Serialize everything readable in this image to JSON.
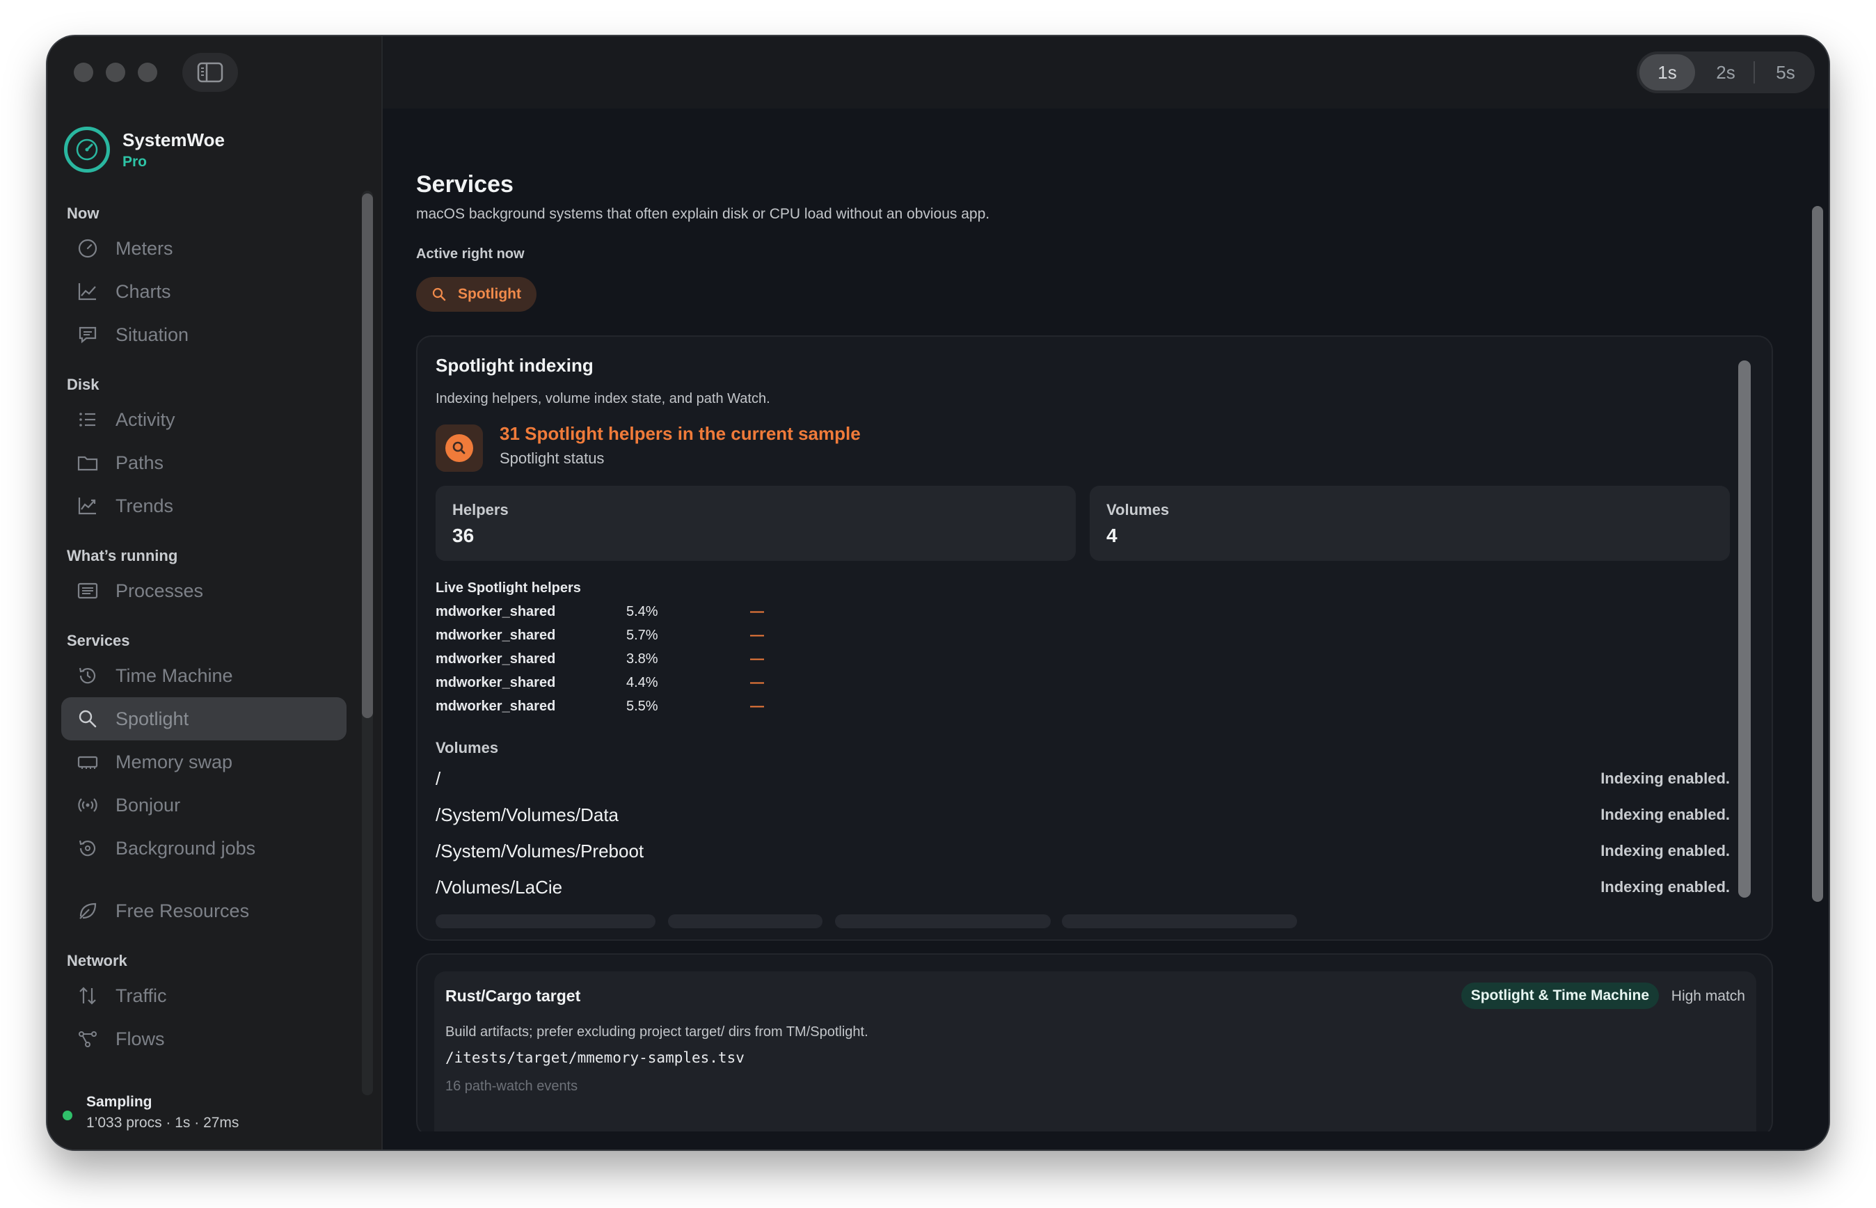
{
  "app": {
    "name": "SystemWoe",
    "tier": "Pro"
  },
  "interval": {
    "options": [
      "1s",
      "2s",
      "5s"
    ],
    "selected": "1s"
  },
  "sidebar": {
    "sections": [
      {
        "title": "Now",
        "items": [
          {
            "label": "Meters",
            "icon": "gauge-icon"
          },
          {
            "label": "Charts",
            "icon": "line-chart-icon"
          },
          {
            "label": "Situation",
            "icon": "message-icon"
          }
        ]
      },
      {
        "title": "Disk",
        "items": [
          {
            "label": "Activity",
            "icon": "list-icon"
          },
          {
            "label": "Paths",
            "icon": "folder-icon"
          },
          {
            "label": "Trends",
            "icon": "trend-icon"
          }
        ]
      },
      {
        "title": "What’s running",
        "items": [
          {
            "label": "Processes",
            "icon": "process-list-icon"
          }
        ]
      },
      {
        "title": "Services",
        "items": [
          {
            "label": "Time Machine",
            "icon": "clock-history-icon"
          },
          {
            "label": "Spotlight",
            "icon": "search-icon"
          },
          {
            "label": "Memory swap",
            "icon": "memory-icon"
          },
          {
            "label": "Bonjour",
            "icon": "broadcast-icon"
          },
          {
            "label": "Background jobs",
            "icon": "background-jobs-icon"
          }
        ]
      },
      {
        "title": "",
        "items": [
          {
            "label": "Free Resources",
            "icon": "leaf-icon"
          }
        ]
      },
      {
        "title": "Network",
        "items": [
          {
            "label": "Traffic",
            "icon": "arrows-updown-icon"
          },
          {
            "label": "Flows",
            "icon": "network-graph-icon"
          }
        ]
      }
    ],
    "active": "Spotlight",
    "status": {
      "title": "Sampling",
      "detail": "1’033 procs · 1s · 27ms",
      "color": "#30c06a"
    }
  },
  "page": {
    "title": "Services",
    "subtitle": "macOS background systems that often explain disk or CPU load without an obvious app.",
    "active_heading": "Active right now",
    "active_pill": "Spotlight"
  },
  "spotlight_card": {
    "title": "Spotlight indexing",
    "subtitle": "Indexing helpers, volume index state, and path Watch.",
    "alert_title": "31 Spotlight helpers in the current sample",
    "alert_sub": "Spotlight status",
    "stats": [
      {
        "label": "Helpers",
        "value": "36"
      },
      {
        "label": "Volumes",
        "value": "4"
      }
    ],
    "live_heading": "Live Spotlight helpers",
    "helpers": [
      {
        "name": "mdworker_shared",
        "cpu": "5.4%",
        "trend": "—"
      },
      {
        "name": "mdworker_shared",
        "cpu": "5.7%",
        "trend": "—"
      },
      {
        "name": "mdworker_shared",
        "cpu": "3.8%",
        "trend": "—"
      },
      {
        "name": "mdworker_shared",
        "cpu": "4.4%",
        "trend": "—"
      },
      {
        "name": "mdworker_shared",
        "cpu": "5.5%",
        "trend": "—"
      }
    ],
    "volumes_heading": "Volumes",
    "volumes": [
      {
        "path": "/",
        "state": "Indexing enabled."
      },
      {
        "path": "/System/Volumes/Data",
        "state": "Indexing enabled."
      },
      {
        "path": "/System/Volumes/Preboot",
        "state": "Indexing enabled."
      },
      {
        "path": "/Volumes/LaCie",
        "state": "Indexing enabled."
      }
    ]
  },
  "rust_card": {
    "title": "Rust/Cargo target",
    "badge": "Spotlight & Time Machine",
    "match": "High match",
    "description": "Build artifacts; prefer excluding project target/ dirs from TM/Spotlight.",
    "path": "/itests/target/mmemory-samples.tsv",
    "events": "16 path-watch events"
  },
  "colors": {
    "accent_orange": "#f07b3a",
    "accent_teal": "#2ab7a0",
    "sampling_green": "#30c06a"
  }
}
